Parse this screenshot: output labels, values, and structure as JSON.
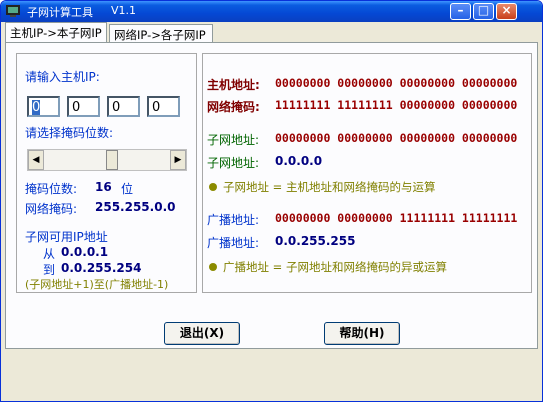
{
  "window": {
    "title": "子网计算工具",
    "version": "V1.1",
    "controls": {
      "minimize": "–",
      "maximize": "□",
      "close": "×"
    }
  },
  "tabs": [
    {
      "label": "主机IP->本子网IP",
      "active": true
    },
    {
      "label": "网络IP->各子网IP",
      "active": false
    }
  ],
  "left": {
    "host_ip_label": "请输入主机IP:",
    "ip_octets": [
      "0",
      "0",
      "0",
      "0"
    ],
    "mask_prompt": "请选择掩码位数:",
    "mask_bits_label": "掩码位数:",
    "mask_bits_value": "16",
    "mask_bits_unit": "位",
    "netmask_label": "网络掩码:",
    "netmask_value": "255.255.0.0",
    "usable_label": "子网可用IP地址",
    "from_label": "从",
    "from_value": "0.0.0.1",
    "to_label": "到",
    "to_value": "0.0.255.254",
    "range_note": "(子网地址+1)至(广播地址-1)",
    "slider_level_bits": 16
  },
  "right": {
    "host_addr_label": "主机地址:",
    "host_addr_bits": "00000000  00000000  00000000  00000000",
    "netmask_label": "网络掩码:",
    "netmask_bits": "11111111  11111111  00000000  00000000",
    "subnet_label": "子网地址:",
    "subnet_bits": "00000000  00000000  00000000  00000000",
    "subnet_addr_label": "子网地址:",
    "subnet_addr_value": "0.0.0.0",
    "subnet_note": "子网地址 = 主机地址和网络掩码的与运算",
    "broadcast_label": "广播地址:",
    "broadcast_bits": "00000000  00000000  11111111  11111111",
    "broadcast_addr_label": "广播地址:",
    "broadcast_addr_value": "0.0.255.255",
    "broadcast_note": "广播地址 = 子网地址和网络掩码的异或运算"
  },
  "buttons": {
    "exit": "退出(X)",
    "help": "帮助(H)"
  },
  "colors": {
    "titlebar": "#0548d4",
    "label_blue": "#0033cc",
    "value_red": "#990000",
    "note_olive": "#808000"
  }
}
